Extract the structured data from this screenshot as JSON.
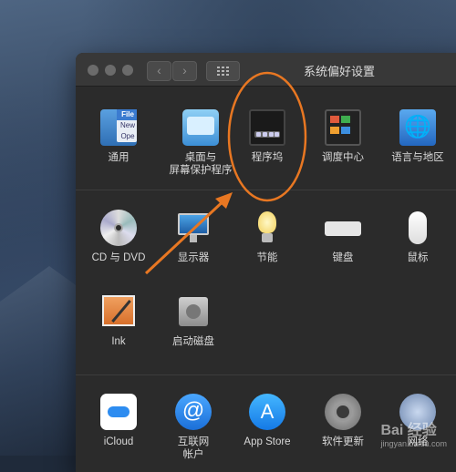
{
  "window": {
    "title": "系统偏好设置"
  },
  "nav": {
    "back": "‹",
    "forward": "›"
  },
  "sections": [
    {
      "items": [
        {
          "label": "通用",
          "icon": "general-icon"
        },
        {
          "label": "桌面与\n屏幕保护程序",
          "icon": "desktop-screensaver-icon"
        },
        {
          "label": "程序坞",
          "icon": "dock-icon"
        },
        {
          "label": "调度中心",
          "icon": "mission-control-icon"
        },
        {
          "label": "语言与地区",
          "icon": "language-region-icon"
        }
      ]
    },
    {
      "items": [
        {
          "label": "CD 与 DVD",
          "icon": "cd-dvd-icon"
        },
        {
          "label": "显示器",
          "icon": "displays-icon"
        },
        {
          "label": "节能",
          "icon": "energy-saver-icon"
        },
        {
          "label": "键盘",
          "icon": "keyboard-icon"
        },
        {
          "label": "鼠标",
          "icon": "mouse-icon"
        },
        {
          "label": "Ink",
          "icon": "ink-icon"
        },
        {
          "label": "启动磁盘",
          "icon": "startup-disk-icon"
        }
      ]
    },
    {
      "items": [
        {
          "label": "iCloud",
          "icon": "icloud-icon"
        },
        {
          "label": "互联网\n帐户",
          "icon": "internet-accounts-icon"
        },
        {
          "label": "App Store",
          "icon": "app-store-icon"
        },
        {
          "label": "软件更新",
          "icon": "software-update-icon"
        },
        {
          "label": "网络",
          "icon": "network-icon"
        }
      ]
    }
  ],
  "icon_text": {
    "general_file": "File",
    "general_new": "New",
    "general_ope": "Ope",
    "inet": "@",
    "appstore": "A",
    "lang": "🌐"
  },
  "watermark": {
    "brand": "Bai 经验",
    "url": "jingyan.baidu.com"
  },
  "colors": {
    "annotation": "#e87722",
    "window_bg": "#2b2b2b",
    "titlebar": "#383838"
  }
}
